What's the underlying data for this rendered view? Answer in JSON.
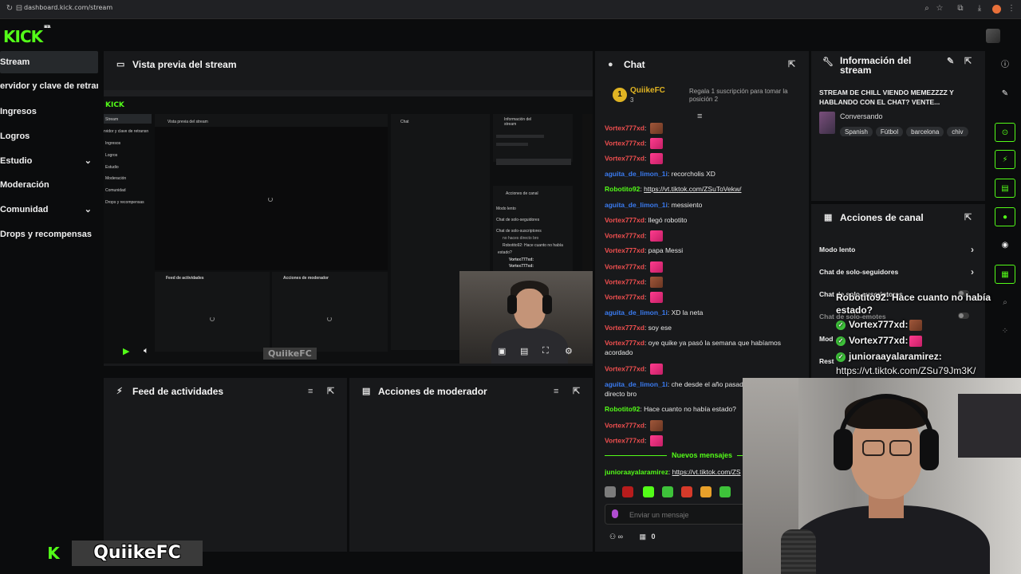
{
  "browser": {
    "url": "dashboard.kick.com/stream"
  },
  "header": {
    "logo": "KICK",
    "logo_sup": "BETA"
  },
  "sidebar": {
    "items": [
      {
        "label": "Stream",
        "active": true
      },
      {
        "label": "ervidor y clave de retransn"
      },
      {
        "label": "Ingresos"
      },
      {
        "label": "Logros"
      },
      {
        "label": "Estudio",
        "chevron": "⌄"
      },
      {
        "label": "Moderación"
      },
      {
        "label": "Comunidad",
        "chevron": "⌄"
      },
      {
        "label": "Drops y recompensas"
      }
    ]
  },
  "preview": {
    "title": "Vista previa del stream",
    "watermark": "QuiikeFC",
    "inner": {
      "logo": "KICK",
      "side": [
        "Stream",
        "rvidor y clave de retransn",
        "Ingresos",
        "Logros",
        "Estudio",
        "Moderación",
        "Comunidad",
        "Drops y recompensas"
      ],
      "preview_title": "Vista previa del stream",
      "chat_title": "Chat",
      "info_title": "Información del stream",
      "feed_title": "Feed de actividades",
      "mod_title": "Acciones de moderador",
      "actions_title": "Acciones de canal",
      "actions": [
        "Modo lento",
        "Chat de solo-seguidores",
        "Chat de solo-suscriptores"
      ],
      "overlay": [
        "no haces directo bro",
        "Robotito92: Hace cuanto no había",
        "estado?",
        "Vortex777xd:",
        "Vortex777xd:"
      ]
    }
  },
  "feed": {
    "title": "Feed de actividades"
  },
  "mod": {
    "title": "Acciones de moderador"
  },
  "chat": {
    "title": "Chat",
    "pinned": {
      "name": "QuiikeFC",
      "rank": "1",
      "count": "3",
      "text": "Regala 1 suscripción para tomar la posición 2"
    },
    "messages": [
      {
        "user": "Vortex777xd",
        "color": "#f04f4f",
        "text": "",
        "emote": "photo"
      },
      {
        "user": "Vortex777xd",
        "color": "#f04f4f",
        "text": "",
        "emote": "pink"
      },
      {
        "user": "Vortex777xd",
        "color": "#f04f4f",
        "text": "",
        "emote": "pink"
      },
      {
        "user": "aguita_de_limon_1i",
        "color": "#3a7bf0",
        "text": "recorcholis XD"
      },
      {
        "user": "Robotito92",
        "color": "#53fc18",
        "text": "https://vt.tiktok.com/ZSuToVekw/",
        "link": true
      },
      {
        "user": "aguita_de_limon_1i",
        "color": "#3a7bf0",
        "text": "messiento"
      },
      {
        "user": "Vortex777xd",
        "color": "#f04f4f",
        "text": "llegó robotito"
      },
      {
        "user": "Vortex777xd",
        "color": "#f04f4f",
        "text": "",
        "emote": "pink"
      },
      {
        "user": "Vortex777xd",
        "color": "#f04f4f",
        "text": "papa Messi"
      },
      {
        "user": "Vortex777xd",
        "color": "#f04f4f",
        "text": "",
        "emote": "pink"
      },
      {
        "user": "Vortex777xd",
        "color": "#f04f4f",
        "text": "",
        "emote": "photo"
      },
      {
        "user": "Vortex777xd",
        "color": "#f04f4f",
        "text": "",
        "emote": "pink"
      },
      {
        "user": "aguita_de_limon_1i",
        "color": "#3a7bf0",
        "text": "XD la neta"
      },
      {
        "user": "Vortex777xd",
        "color": "#f04f4f",
        "text": "soy ese"
      },
      {
        "user": "Vortex777xd",
        "color": "#f04f4f",
        "text": "oye quike ya pasó la semana que habíamos"
      },
      {
        "user": "",
        "color": "#e6e6e6",
        "text": "acordado"
      },
      {
        "user": "Vortex777xd",
        "color": "#f04f4f",
        "text": "",
        "emote": "pink"
      },
      {
        "user": "aguita_de_limon_1i",
        "color": "#3a7bf0",
        "text": "che desde el año pasad"
      },
      {
        "user": "",
        "color": "#e6e6e6",
        "text": "directo bro"
      },
      {
        "user": "Robotito92",
        "color": "#53fc18",
        "text": "Hace cuanto no había estado?"
      },
      {
        "user": "Vortex777xd",
        "color": "#f04f4f",
        "text": "",
        "emote": "photo"
      },
      {
        "user": "Vortex777xd",
        "color": "#f04f4f",
        "text": "",
        "emote": "pink"
      }
    ],
    "new_messages": "Nuevos mensajes",
    "last": {
      "user": "junioraayalaramirez",
      "color": "#53fc18",
      "text": "https://vt.tiktok.com/ZS"
    },
    "input_placeholder": "Enviar un mensaje",
    "viewers": "0"
  },
  "info": {
    "title": "Información del stream",
    "stream_title": "STREAM DE CHILL VIENDO MEMEZZZZ Y HABLANDO CON EL CHAT? VENTE...",
    "category": "Conversando",
    "tags": [
      "Spanish",
      "Fútbol",
      "barcelona",
      "chiv"
    ]
  },
  "actions": {
    "title": "Acciones de canal",
    "rows": [
      {
        "label": "Modo lento",
        "kind": "arrow"
      },
      {
        "label": "Chat de solo-seguidores",
        "kind": "arrow"
      },
      {
        "label": "Chat de solo-suscriptores",
        "kind": "toggle"
      },
      {
        "label": "Chat de solo-emotes",
        "kind": "toggle"
      },
      {
        "label": "Mod",
        "kind": "none"
      },
      {
        "label": "Rest",
        "kind": "none"
      }
    ]
  },
  "overlay": {
    "lines": [
      {
        "text": "Robotito92: Hace cuanto no había",
        "chk": false
      },
      {
        "text": "estado?",
        "chk": false
      },
      {
        "text": "Vortex777xd:",
        "chk": true
      },
      {
        "text": "Vortex777xd:",
        "chk": true
      },
      {
        "text": "junioraayalaramirez:",
        "chk": true
      },
      {
        "text": "https://vt.tiktok.com/ZSu79Jm3K/",
        "chk": false
      }
    ]
  },
  "watermark": {
    "k": "K",
    "name": "QuiikeFC"
  },
  "colors": {
    "accent": "#53fc18",
    "panel": "#18191b",
    "bg": "#0b0c0d"
  }
}
